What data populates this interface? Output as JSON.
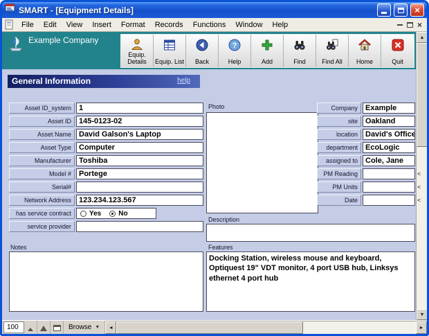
{
  "window": {
    "title": "SMART - [Equipment Details]"
  },
  "menu": {
    "items": [
      "File",
      "Edit",
      "View",
      "Insert",
      "Format",
      "Records",
      "Functions",
      "Window",
      "Help"
    ]
  },
  "toolbar": {
    "company_name": "Example Company",
    "buttons": [
      {
        "label": "Equip. Details",
        "icon": "equip-details-icon"
      },
      {
        "label": "Equip. List",
        "icon": "equip-list-icon"
      },
      {
        "label": "Back",
        "icon": "back-icon"
      },
      {
        "label": "Help",
        "icon": "help-icon"
      },
      {
        "label": "Add",
        "icon": "add-icon"
      },
      {
        "label": "Find",
        "icon": "find-icon"
      },
      {
        "label": "Find All",
        "icon": "find-all-icon"
      },
      {
        "label": "Home",
        "icon": "home-icon"
      },
      {
        "label": "Quit",
        "icon": "quit-icon"
      }
    ]
  },
  "section": {
    "title": "General Information",
    "help": "help"
  },
  "form": {
    "left_fields": [
      {
        "label": "Asset ID_system",
        "value": "1"
      },
      {
        "label": "Asset ID",
        "value": "145-0123-02"
      },
      {
        "label": "Asset Name",
        "value": "David Galson's Laptop"
      },
      {
        "label": "Asset Type",
        "value": "Computer"
      },
      {
        "label": "Manufacturer",
        "value": "Toshiba"
      },
      {
        "label": "Model #",
        "value": "Portege"
      },
      {
        "label": "Serial#",
        "value": ""
      },
      {
        "label": "Network Address",
        "value": "123.234.123.567"
      }
    ],
    "service_contract": {
      "label": "has service contract",
      "options": [
        "Yes",
        "No"
      ],
      "selected": "No"
    },
    "service_provider": {
      "label": "service provider",
      "value": ""
    },
    "photo": {
      "label": "Photo"
    },
    "right_fields": [
      {
        "label": "Company",
        "value": "Example"
      },
      {
        "label": "site",
        "value": "Oakland"
      },
      {
        "label": "location",
        "value": "David's Office"
      },
      {
        "label": "department",
        "value": "EcoLogic"
      },
      {
        "label": "assigned to",
        "value": "Cole, Jane"
      },
      {
        "label": "PM Reading",
        "value": "",
        "indicator": "<"
      },
      {
        "label": "PM Units",
        "value": "",
        "indicator": "<"
      },
      {
        "label": "Date",
        "value": "",
        "indicator": "<"
      }
    ],
    "description": {
      "label": "Description",
      "value": ""
    },
    "notes": {
      "label": "Notes",
      "value": ""
    },
    "features": {
      "label": "Features",
      "value": "Docking Station, wireless mouse and keyboard, Optiquest 19\" VDT monitor, 4 port USB hub, Linksys ethernet 4 port hub"
    }
  },
  "statusbar": {
    "zoom": "100",
    "mode": "Browse"
  }
}
